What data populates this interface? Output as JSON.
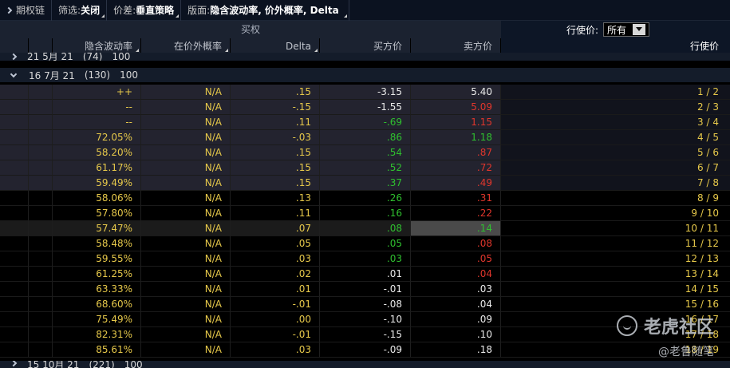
{
  "toolbar": {
    "chain_label": "期权链",
    "filter_label": "筛选:",
    "filter_value": "关闭",
    "spread_label": "价差:",
    "spread_value": "垂直策略",
    "layout_label": "版面:",
    "layout_value": "隐含波动率, 价外概率, Delta"
  },
  "calls_title": "买权",
  "strike_filter": {
    "label": "行使价:",
    "value": "所有"
  },
  "columns": {
    "iv": "隐含波动率",
    "prob_otm": "在价外概率",
    "delta": "Delta",
    "bid": "买方价",
    "ask": "卖方价",
    "strike": "行使价"
  },
  "expiries": [
    {
      "date": "21 5月 21",
      "days": "(74)",
      "mult": "100"
    },
    {
      "date": "16 7月 21",
      "days": "(130)",
      "mult": "100"
    },
    {
      "date": "15 10月 21",
      "days": "(221)",
      "mult": "100"
    }
  ],
  "rows": [
    {
      "iv": "++",
      "prob": "N/A",
      "delta": ".15",
      "bid": "-3.15",
      "ask": "5.40",
      "strike": "1 / 2",
      "bid_color": "wht",
      "ask_color": "wht",
      "itm": true
    },
    {
      "iv": "--",
      "prob": "N/A",
      "delta": "-.15",
      "bid": "-1.55",
      "ask": "5.09",
      "strike": "2 / 3",
      "bid_color": "wht",
      "ask_color": "red",
      "itm": true
    },
    {
      "iv": "--",
      "prob": "N/A",
      "delta": ".11",
      "bid": "-.69",
      "ask": "1.15",
      "strike": "3 / 4",
      "bid_color": "grn",
      "ask_color": "red",
      "itm": true
    },
    {
      "iv": "72.05%",
      "prob": "N/A",
      "delta": "-.03",
      "bid": ".86",
      "ask": "1.18",
      "strike": "4 / 5",
      "bid_color": "grn",
      "ask_color": "grn",
      "itm": true
    },
    {
      "iv": "58.20%",
      "prob": "N/A",
      "delta": ".15",
      "bid": ".54",
      "ask": ".87",
      "strike": "5 / 6",
      "bid_color": "grn",
      "ask_color": "red",
      "itm": true
    },
    {
      "iv": "61.17%",
      "prob": "N/A",
      "delta": ".15",
      "bid": ".52",
      "ask": ".72",
      "strike": "6 / 7",
      "bid_color": "grn",
      "ask_color": "red",
      "itm": true
    },
    {
      "iv": "59.49%",
      "prob": "N/A",
      "delta": ".15",
      "bid": ".37",
      "ask": ".49",
      "strike": "7 / 8",
      "bid_color": "grn",
      "ask_color": "red",
      "itm": true
    },
    {
      "iv": "58.06%",
      "prob": "N/A",
      "delta": ".13",
      "bid": ".26",
      "ask": ".31",
      "strike": "8 / 9",
      "bid_color": "grn",
      "ask_color": "red",
      "itm": false
    },
    {
      "iv": "57.80%",
      "prob": "N/A",
      "delta": ".11",
      "bid": ".16",
      "ask": ".22",
      "strike": "9 / 10",
      "bid_color": "grn",
      "ask_color": "red",
      "itm": false
    },
    {
      "iv": "57.47%",
      "prob": "N/A",
      "delta": ".07",
      "bid": ".08",
      "ask": ".14",
      "strike": "10 / 11",
      "bid_color": "grn",
      "ask_color": "grn",
      "itm": false,
      "selected": true
    },
    {
      "iv": "58.48%",
      "prob": "N/A",
      "delta": ".05",
      "bid": ".05",
      "ask": ".08",
      "strike": "11 / 12",
      "bid_color": "grn",
      "ask_color": "red",
      "itm": false
    },
    {
      "iv": "59.55%",
      "prob": "N/A",
      "delta": ".03",
      "bid": ".03",
      "ask": ".05",
      "strike": "12 / 13",
      "bid_color": "grn",
      "ask_color": "red",
      "itm": false
    },
    {
      "iv": "61.25%",
      "prob": "N/A",
      "delta": ".02",
      "bid": ".01",
      "ask": ".04",
      "strike": "13 / 14",
      "bid_color": "wht",
      "ask_color": "red",
      "itm": false
    },
    {
      "iv": "63.33%",
      "prob": "N/A",
      "delta": ".01",
      "bid": "-.01",
      "ask": ".03",
      "strike": "14 / 15",
      "bid_color": "wht",
      "ask_color": "wht",
      "itm": false
    },
    {
      "iv": "68.60%",
      "prob": "N/A",
      "delta": "-.01",
      "bid": "-.08",
      "ask": ".04",
      "strike": "15 / 16",
      "bid_color": "wht",
      "ask_color": "wht",
      "itm": false
    },
    {
      "iv": "75.49%",
      "prob": "N/A",
      "delta": ".00",
      "bid": "-.10",
      "ask": ".09",
      "strike": "16 / 17",
      "bid_color": "wht",
      "ask_color": "wht",
      "itm": false
    },
    {
      "iv": "82.31%",
      "prob": "N/A",
      "delta": "-.01",
      "bid": "-.15",
      "ask": ".10",
      "strike": "17 / 18",
      "bid_color": "wht",
      "ask_color": "wht",
      "itm": false
    },
    {
      "iv": "85.61%",
      "prob": "N/A",
      "delta": ".03",
      "bid": "-.09",
      "ask": ".18",
      "strike": "18 / 19",
      "bid_color": "wht",
      "ask_color": "wht",
      "itm": false
    }
  ],
  "watermark": {
    "brand": "老虎社区",
    "author": "@老鲁随笔"
  }
}
